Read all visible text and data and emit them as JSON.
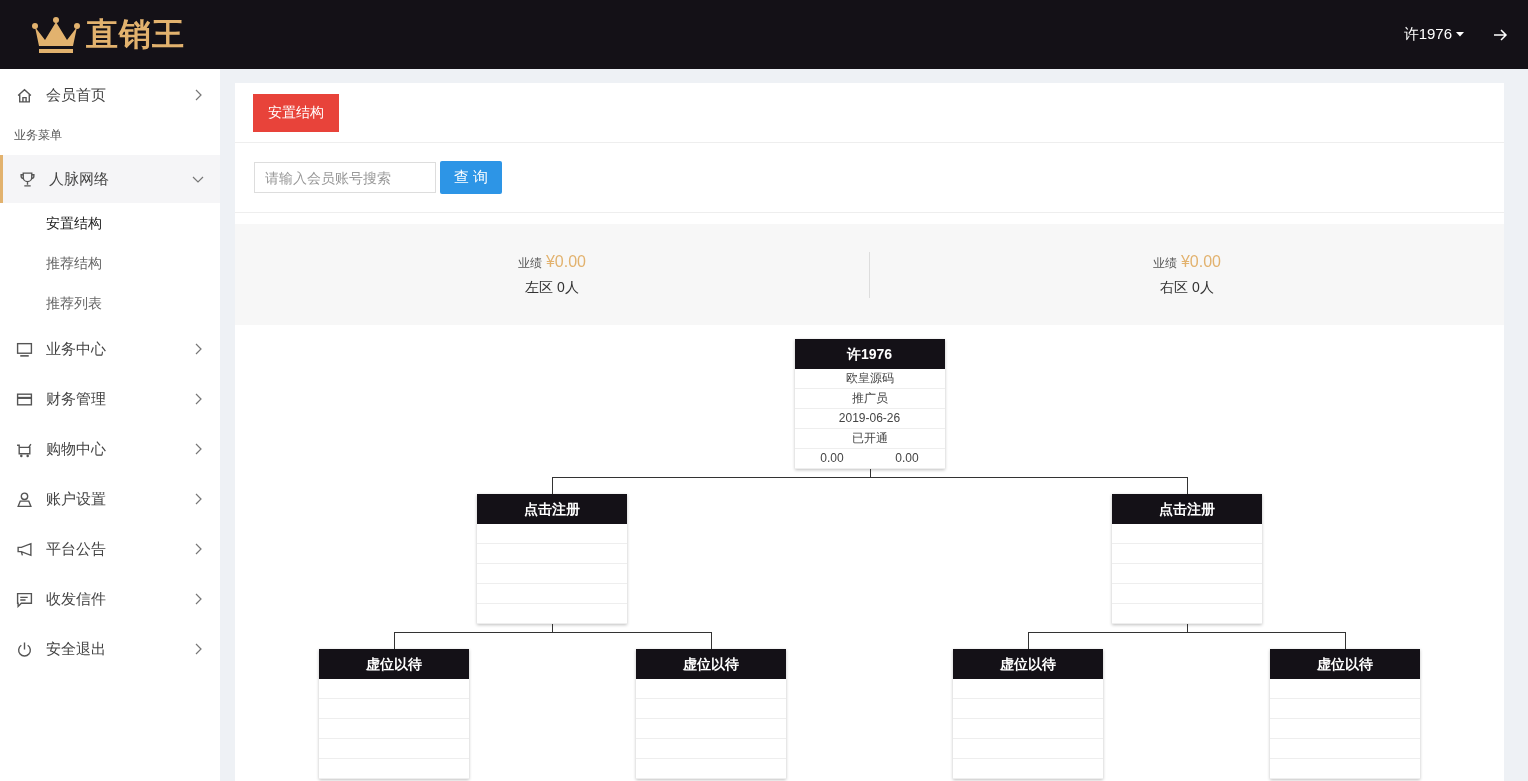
{
  "header": {
    "logo_text": "直销王",
    "user": "许1976"
  },
  "sidebar": {
    "items": [
      {
        "kind": "item",
        "label": "会员首页",
        "selected": false,
        "expanded": false
      },
      {
        "kind": "section",
        "label": "业务菜单"
      },
      {
        "kind": "item",
        "label": "人脉网络",
        "selected": true,
        "expanded": true,
        "children": [
          {
            "label": "安置结构",
            "selected": true
          },
          {
            "label": "推荐结构",
            "selected": false
          },
          {
            "label": "推荐列表",
            "selected": false
          }
        ]
      },
      {
        "kind": "item",
        "label": "业务中心",
        "selected": false,
        "expanded": false
      },
      {
        "kind": "item",
        "label": "财务管理",
        "selected": false,
        "expanded": false
      },
      {
        "kind": "item",
        "label": "购物中心",
        "selected": false,
        "expanded": false
      },
      {
        "kind": "item",
        "label": "账户设置",
        "selected": false,
        "expanded": false
      },
      {
        "kind": "item",
        "label": "平台公告",
        "selected": false,
        "expanded": false
      },
      {
        "kind": "item",
        "label": "收发信件",
        "selected": false,
        "expanded": false
      },
      {
        "kind": "item",
        "label": "安全退出",
        "selected": false,
        "expanded": false
      }
    ]
  },
  "page_tab": "安置结构",
  "search": {
    "placeholder": "请输入会员账号搜索",
    "button": "查 询"
  },
  "stats": [
    {
      "label": "业绩",
      "amount": "¥0.00",
      "zone": "左区 0人"
    },
    {
      "label": "业绩",
      "amount": "¥0.00",
      "zone": "右区 0人"
    }
  ],
  "tree": {
    "kind": "member",
    "title": "许1976",
    "lines": [
      "欧皇源码",
      "推广员",
      "2019-06-26",
      "已开通"
    ],
    "values": [
      "0.00",
      "0.00"
    ],
    "children": [
      {
        "kind": "empty",
        "title": "点击注册",
        "children": [
          {
            "kind": "empty",
            "title": "虚位以待"
          },
          {
            "kind": "empty",
            "title": "虚位以待"
          }
        ]
      },
      {
        "kind": "empty",
        "title": "点击注册",
        "children": [
          {
            "kind": "empty",
            "title": "虚位以待"
          },
          {
            "kind": "empty",
            "title": "虚位以待"
          }
        ]
      }
    ]
  }
}
